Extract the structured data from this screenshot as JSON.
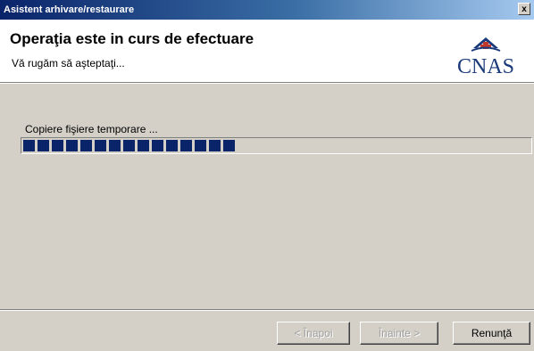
{
  "window": {
    "title": "Asistent arhivare/restaurare",
    "close_glyph": "x"
  },
  "header": {
    "title": "Operaţia este in curs de efectuare",
    "subtitle": "Vă rugăm să aşteptaţi...",
    "logo_text": "CNAS",
    "logo_color": "#1b3a7a",
    "logo_accent_color": "#c0392b"
  },
  "main": {
    "status_text": "Copiere fişiere temporare ...",
    "progress": {
      "fraction": 0.44,
      "filled_blocks": 15,
      "fill_color": "#0a246a"
    }
  },
  "footer": {
    "back_label": "< Înapoi",
    "next_label": "Înainte >",
    "cancel_label": "Renunţă"
  }
}
